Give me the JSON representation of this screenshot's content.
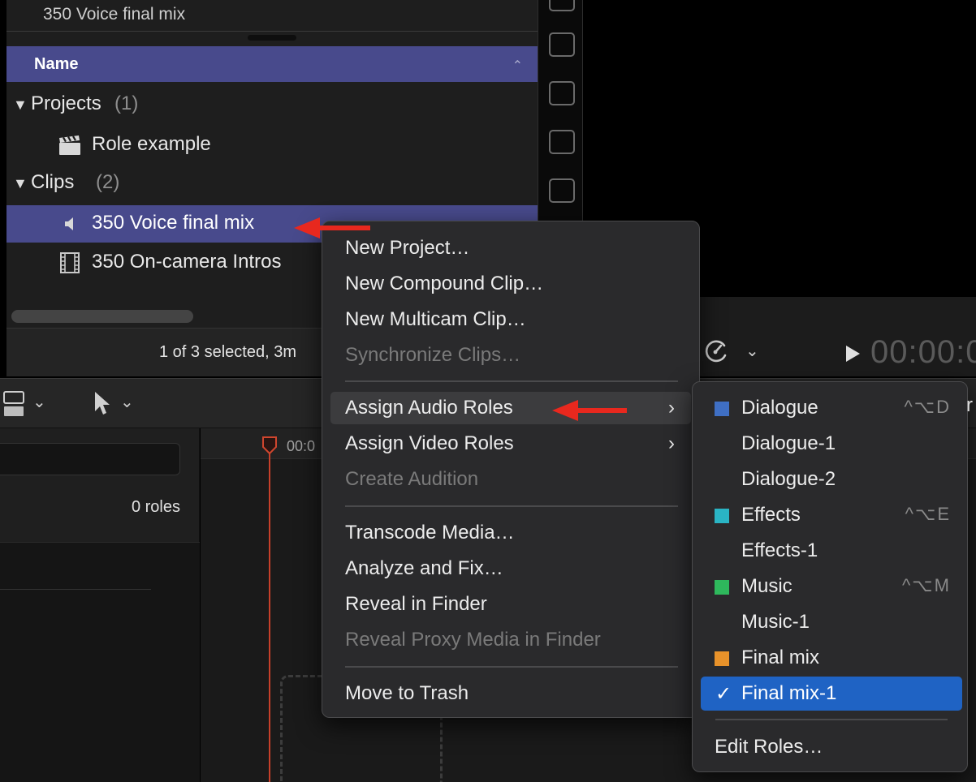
{
  "browser": {
    "top_clip_name": "350 Voice final mix",
    "column_header": "Name",
    "groups": [
      {
        "label": "Projects",
        "count": "(1)"
      },
      {
        "label": "Clips",
        "count": "(2)"
      }
    ],
    "items": [
      {
        "label": "Role example",
        "icon": "clapperboard-icon"
      },
      {
        "label": "350 Voice final mix",
        "icon": "speaker-icon"
      },
      {
        "label": "350 On-camera Intros",
        "icon": "film-strip-icon"
      }
    ],
    "status": "1 of 3 selected, 3m"
  },
  "viewer": {
    "timecode": "00:00:0"
  },
  "timeline_index": {
    "roles_count": "0 roles"
  },
  "timeline": {
    "ruler_label": "00:0"
  },
  "context_menu": {
    "items": [
      {
        "label": "New Project…"
      },
      {
        "label": "New Compound Clip…"
      },
      {
        "label": "New Multicam Clip…"
      },
      {
        "label": "Synchronize Clips…"
      },
      {
        "label": "Assign Audio Roles"
      },
      {
        "label": "Assign Video Roles"
      },
      {
        "label": "Create Audition"
      },
      {
        "label": "Transcode Media…"
      },
      {
        "label": "Analyze and Fix…"
      },
      {
        "label": "Reveal in Finder"
      },
      {
        "label": "Reveal Proxy Media in Finder"
      },
      {
        "label": "Move to Trash"
      }
    ]
  },
  "roles_submenu": {
    "items": [
      {
        "label": "Dialogue",
        "shortcut": "^⌥D",
        "color": "#3f6fc4"
      },
      {
        "label": "Dialogue-1"
      },
      {
        "label": "Dialogue-2"
      },
      {
        "label": "Effects",
        "shortcut": "^⌥E",
        "color": "#2ab4c4"
      },
      {
        "label": "Effects-1"
      },
      {
        "label": "Music",
        "shortcut": "^⌥M",
        "color": "#2eb85c"
      },
      {
        "label": "Music-1"
      },
      {
        "label": "Final mix",
        "color": "#e8922a"
      },
      {
        "label": "Final mix-1",
        "checkmark": "✓"
      },
      {
        "label": "Edit Roles…"
      }
    ]
  },
  "colors": {
    "selection": "#484a8c",
    "menu_highlight": "#1f63c4",
    "annotation_arrow": "#e8281e"
  }
}
